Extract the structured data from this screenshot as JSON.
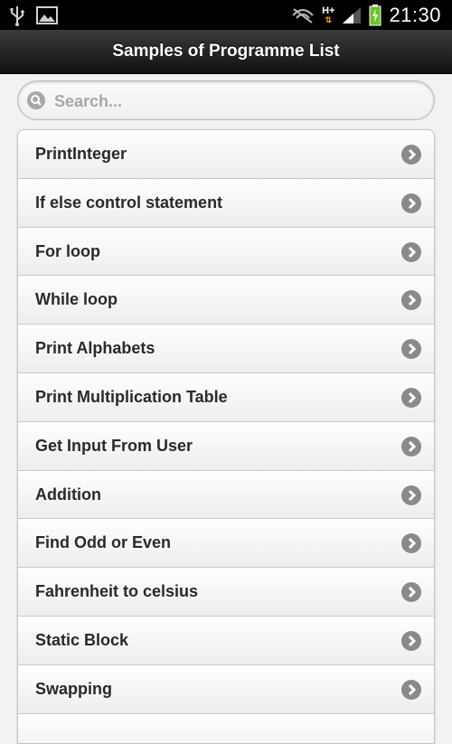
{
  "status_bar": {
    "time": "21:30",
    "network": "H+",
    "icons": [
      "usb-icon",
      "gallery-icon",
      "no-signal-muted-icon",
      "network-hplus-icon",
      "signal-bars-icon",
      "battery-charging-icon"
    ]
  },
  "header": {
    "title": "Samples of Programme List"
  },
  "search": {
    "placeholder": "Search..."
  },
  "list": {
    "items": [
      {
        "label": "PrintInteger"
      },
      {
        "label": "If else control statement"
      },
      {
        "label": "For loop"
      },
      {
        "label": "While loop"
      },
      {
        "label": "Print Alphabets"
      },
      {
        "label": "Print Multiplication Table"
      },
      {
        "label": "Get Input From User"
      },
      {
        "label": "Addition"
      },
      {
        "label": "Find Odd or Even"
      },
      {
        "label": "Fahrenheit to celsius"
      },
      {
        "label": "Static Block"
      },
      {
        "label": "Swapping"
      },
      {
        "label": ""
      }
    ]
  },
  "colors": {
    "header_bg": "#1e1e1e",
    "list_text": "#2a2a2a",
    "arrow_bg": "#8a8a8a",
    "battery": "#6ac229"
  }
}
